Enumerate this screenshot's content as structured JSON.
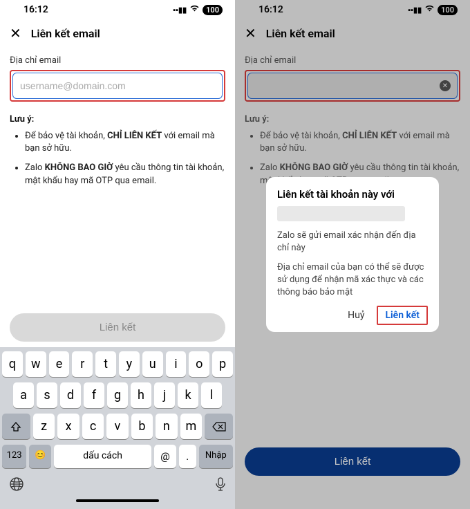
{
  "status": {
    "time": "16:12",
    "battery": "100"
  },
  "header": {
    "title": "Liên kết email"
  },
  "email": {
    "label": "Địa chỉ email",
    "placeholder": "username@domain.com"
  },
  "notes": {
    "title": "Lưu ý:",
    "item1_pre": "Để bảo vệ tài khoản, ",
    "item1_b": "CHỈ LIÊN KẾT",
    "item1_post": " với email mà bạn sở hữu.",
    "item2_pre": "Zalo ",
    "item2_b": "KHÔNG BAO GIỜ",
    "item2_post": " yêu cầu thông tin tài khoản, mật khẩu hay mã OTP qua email."
  },
  "button": {
    "link": "Liên kết"
  },
  "keyboard": {
    "r1": {
      "k0": "q",
      "k1": "w",
      "k2": "e",
      "k3": "r",
      "k4": "t",
      "k5": "y",
      "k6": "u",
      "k7": "i",
      "k8": "o",
      "k9": "p"
    },
    "r2": {
      "k0": "a",
      "k1": "s",
      "k2": "d",
      "k3": "f",
      "k4": "g",
      "k5": "h",
      "k6": "j",
      "k7": "k",
      "k8": "l"
    },
    "r3": {
      "k0": "z",
      "k1": "x",
      "k2": "c",
      "k3": "v",
      "k4": "b",
      "k5": "n",
      "k6": "m"
    },
    "num": "123",
    "emoji": "😊",
    "space": "dấu cách",
    "at": "@",
    "dot": ".",
    "enter": "Nhập"
  },
  "dialog": {
    "title": "Liên kết tài khoản này với",
    "text1": "Zalo sẽ gửi email xác nhận đến địa chỉ này",
    "text2": "Địa chỉ email của bạn có thể sẽ được sử dụng để nhận mã xác thực và các thông báo bảo mật",
    "cancel": "Huỷ",
    "link": "Liên kết"
  }
}
